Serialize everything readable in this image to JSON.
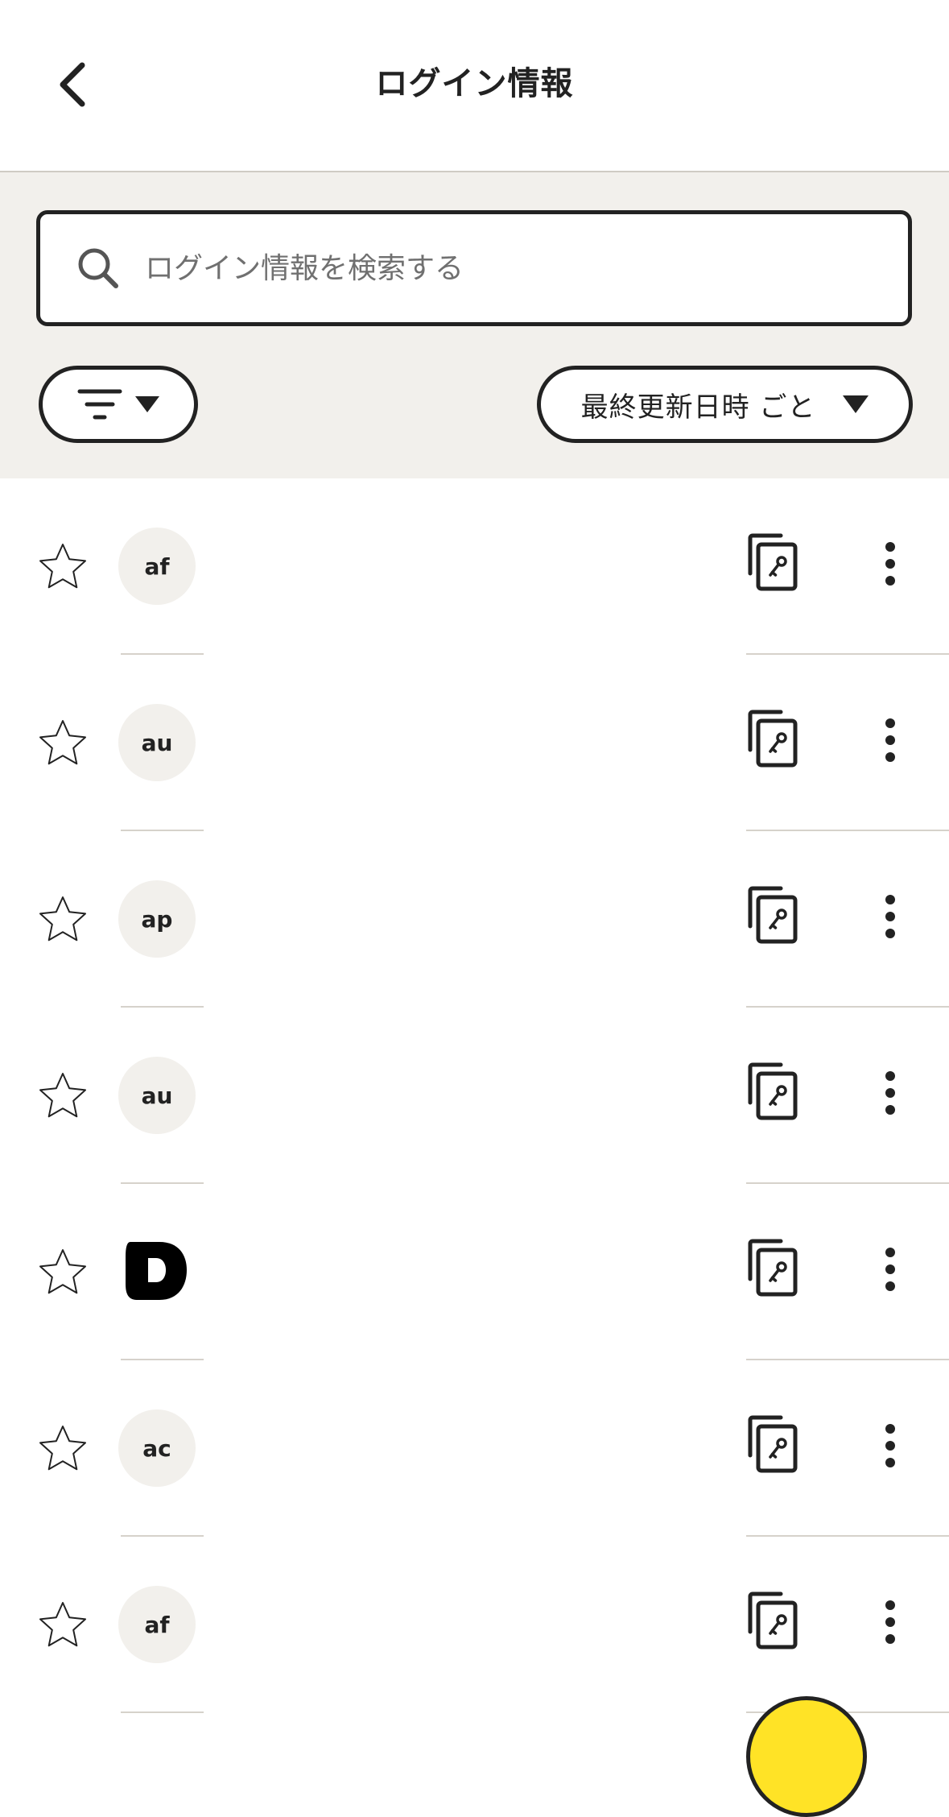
{
  "header": {
    "title": "ログイン情報",
    "back_icon": "chevron-left-icon"
  },
  "search": {
    "placeholder": "ログイン情報を検索する",
    "value": "",
    "icon": "search-icon"
  },
  "filter": {
    "icon": "filter-icon",
    "caret": "caret-down-icon"
  },
  "sort": {
    "label": "最終更新日時 ごと",
    "caret": "caret-down-icon"
  },
  "logins": [
    {
      "avatar_text": "af",
      "favorite": false
    },
    {
      "avatar_text": "au",
      "favorite": false
    },
    {
      "avatar_text": "ap",
      "favorite": false
    },
    {
      "avatar_text": "au",
      "favorite": false
    },
    {
      "avatar_text": "D",
      "avatar_logo": true,
      "favorite": false
    },
    {
      "avatar_text": "ac",
      "favorite": false
    },
    {
      "avatar_text": "af",
      "favorite": false
    }
  ],
  "row_actions": {
    "copy_icon": "copy-key-icon",
    "more_icon": "more-vertical-icon"
  },
  "colors": {
    "text": "#222222",
    "controls_bg": "#f2f0ec",
    "avatar_bg": "#f2f0ec",
    "divider": "#d6d2cb",
    "fab": "#ffe326"
  }
}
